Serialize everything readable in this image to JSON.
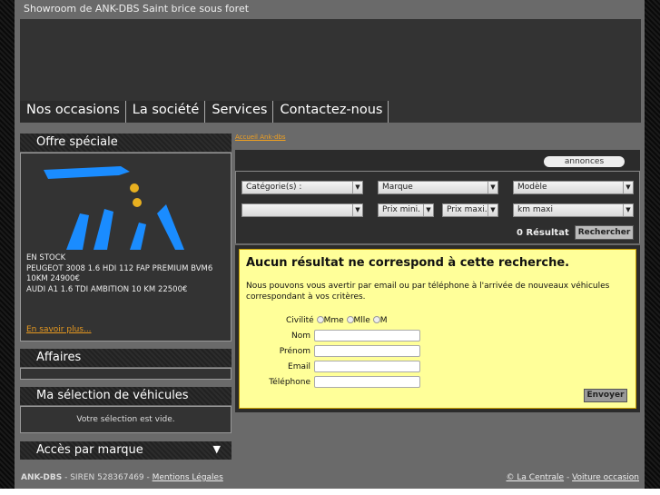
{
  "header": {
    "title": "Showroom de ANK-DBS Saint brice sous foret"
  },
  "nav": [
    "Nos occasions",
    "La société",
    "Services",
    "Contactez-nous"
  ],
  "sidebar": {
    "offre": {
      "title": "Offre spéciale",
      "lines": [
        "EN STOCK",
        "PEUGEOT 3008 1.6 HDI 112 FAP PREMIUM BVM6 10KM 24900€",
        "AUDI A1 1.6 TDI AMBITION 10 KM 22500€"
      ],
      "link": "En savoir plus..."
    },
    "affaires": {
      "title": "Affaires"
    },
    "selection": {
      "title": "Ma sélection de véhicules",
      "empty": "Votre sélection est vide."
    },
    "marque": {
      "title": "Accès par marque"
    }
  },
  "breadcrumb": "Accueil Ank-dbs",
  "search": {
    "tab": "annonces",
    "categorie": "Catégorie(s) :",
    "marque": "Marque",
    "modele": "Modèle",
    "blank": "",
    "prix_min": "Prix mini.",
    "prix_max": "Prix maxi.",
    "km": "km maxi",
    "result": "0 Résultat",
    "button": "Rechercher"
  },
  "alert": {
    "title": "Aucun résultat ne correspond à cette recherche.",
    "text": "Nous pouvons vous avertir par email ou par téléphone à l'arrivée de nouveaux véhicules correspondant à vos critères.",
    "civilite": "Civilité",
    "options": [
      "Mme",
      "Mlle",
      "M"
    ],
    "nom": "Nom",
    "prenom": "Prénom",
    "email": "Email",
    "telephone": "Téléphone",
    "submit": "Envoyer"
  },
  "footer": {
    "brand": "ANK-DBS",
    "siren": " - SIREN 528367469 - ",
    "mentions": "Mentions Légales",
    "centrale": "© La Centrale",
    "sep": " - ",
    "voiture": "Voiture occasion"
  }
}
